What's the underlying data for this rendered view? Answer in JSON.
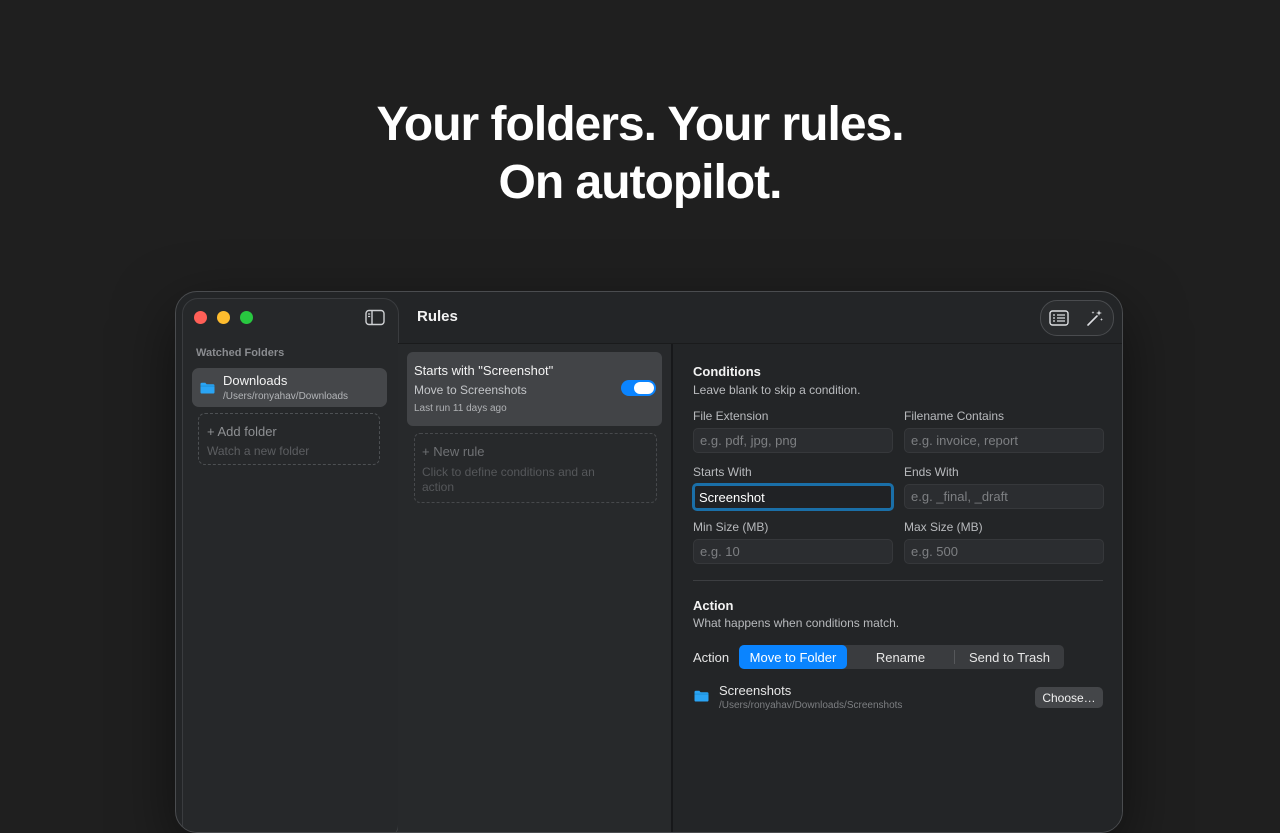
{
  "hero": {
    "line1": "Your folders. Your rules.",
    "line2": "On autopilot."
  },
  "sidebar": {
    "section_label": "Watched Folders",
    "folders": [
      {
        "name": "Downloads",
        "path": "/Users/ronyahav/Downloads",
        "icon": "folder-icon",
        "selected": true
      }
    ],
    "add_folder": {
      "label": "+ Add folder",
      "hint": "Watch a new folder"
    }
  },
  "toolbar": {
    "title": "Rules",
    "buttons": [
      "rules-list-icon",
      "magic-wand-icon"
    ]
  },
  "rules": {
    "items": [
      {
        "title": "Starts with \"Screenshot\"",
        "action": "Move to Screenshots",
        "last_run": "Last run 11 days ago",
        "enabled": true
      }
    ],
    "new_rule": {
      "label": "+ New rule",
      "hint": "Click to define conditions and an action"
    }
  },
  "conditions": {
    "title": "Conditions",
    "subtitle": "Leave blank to skip a condition.",
    "fields": {
      "file_extension": {
        "label": "File Extension",
        "value": "",
        "placeholder": "e.g. pdf, jpg, png"
      },
      "filename_contains": {
        "label": "Filename Contains",
        "value": "",
        "placeholder": "e.g. invoice, report"
      },
      "starts_with": {
        "label": "Starts With",
        "value": "Screenshot",
        "placeholder": ""
      },
      "ends_with": {
        "label": "Ends With",
        "value": "",
        "placeholder": "e.g. _final, _draft"
      },
      "min_size": {
        "label": "Min Size (MB)",
        "value": "",
        "placeholder": "e.g. 10"
      },
      "max_size": {
        "label": "Max Size (MB)",
        "value": "",
        "placeholder": "e.g. 500"
      }
    }
  },
  "action": {
    "title": "Action",
    "subtitle": "What happens when conditions match.",
    "label": "Action",
    "options": [
      "Move to Folder",
      "Rename",
      "Send to Trash"
    ],
    "selected": "Move to Folder",
    "destination": {
      "name": "Screenshots",
      "path": "/Users/ronyahav/Downloads/Screenshots",
      "choose_label": "Choose…"
    }
  },
  "colors": {
    "accent": "#0a84ff",
    "folder_icon": "#2aa4f4",
    "background": "#1f1f1f",
    "traffic_red": "#ff5f57",
    "traffic_yellow": "#febc2e",
    "traffic_green": "#28c840"
  }
}
